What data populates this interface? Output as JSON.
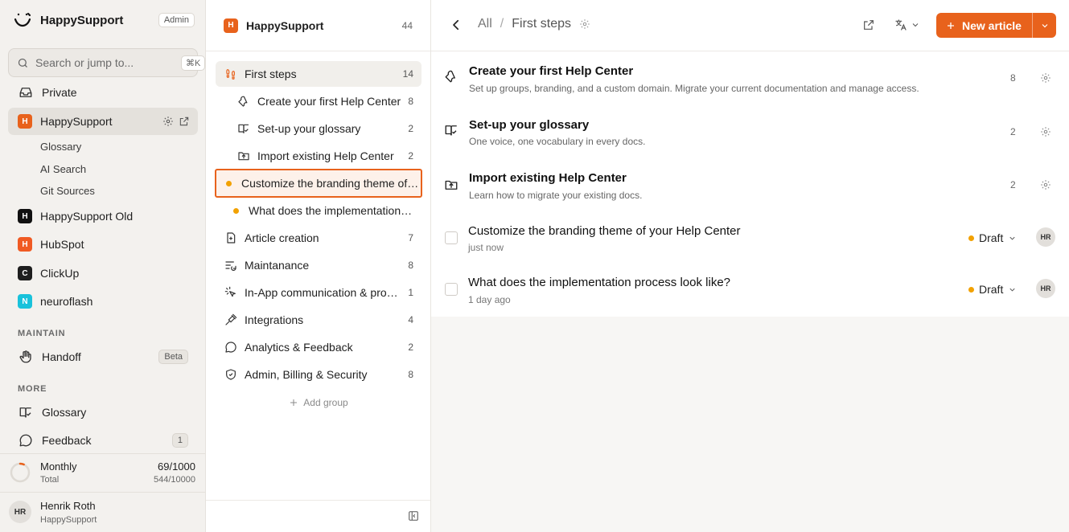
{
  "app": {
    "name": "HappySupport",
    "role_badge": "Admin"
  },
  "search": {
    "placeholder": "Search or jump to...",
    "shortcut": "⌘K"
  },
  "sidebar": {
    "private_label": "Private",
    "active_workspace": {
      "letter": "H",
      "name": "HappySupport",
      "color": "#e8621c"
    },
    "sub_items": [
      "Glossary",
      "AI Search",
      "Git Sources"
    ],
    "workspaces": [
      {
        "letter": "H",
        "name": "HappySupport Old",
        "color": "#111111"
      },
      {
        "letter": "H",
        "name": "HubSpot",
        "color": "#f05a23"
      },
      {
        "letter": "C",
        "name": "ClickUp",
        "color": "#1e1e1e"
      },
      {
        "letter": "N",
        "name": "neuroflash",
        "color": "#19c2db"
      }
    ],
    "maintain_label": "MAINTAIN",
    "handoff": {
      "label": "Handoff",
      "badge": "Beta"
    },
    "more_label": "MORE",
    "glossary_label": "Glossary",
    "feedback": {
      "label": "Feedback",
      "count": "1"
    },
    "usage": {
      "label": "Monthly",
      "sublabel": "Total",
      "monthly": "69/1000",
      "total": "544/10000",
      "fraction": 0.069
    },
    "user": {
      "initials": "HR",
      "name": "Henrik Roth",
      "org": "HappySupport"
    }
  },
  "middle": {
    "header": {
      "letter": "H",
      "name": "HappySupport",
      "count": "44"
    },
    "active_group": {
      "label": "First steps",
      "count": "14"
    },
    "children": [
      {
        "label": "Create your first Help Center",
        "count": "8"
      },
      {
        "label": "Set-up your glossary",
        "count": "2"
      },
      {
        "label": "Import existing Help Center",
        "count": "2"
      }
    ],
    "drafts": [
      {
        "label": "Customize the branding theme of your Help Center"
      },
      {
        "label": "What does the implementation process look like?"
      }
    ],
    "groups": [
      {
        "label": "Article creation",
        "count": "7"
      },
      {
        "label": "Maintanance",
        "count": "8"
      },
      {
        "label": "In-App communication & proactive support",
        "count": "1"
      },
      {
        "label": "Integrations",
        "count": "4"
      },
      {
        "label": "Analytics & Feedback",
        "count": "2"
      },
      {
        "label": "Admin, Billing & Security",
        "count": "8"
      }
    ],
    "add_group_label": "Add group"
  },
  "main": {
    "breadcrumb": {
      "root": "All",
      "sep": "/",
      "current": "First steps"
    },
    "new_article_label": "New article",
    "folders": [
      {
        "title": "Create your first Help Center",
        "desc": "Set up groups, branding, and a custom domain. Migrate your current documentation and manage access.",
        "count": "8",
        "icon": "wrench-icon"
      },
      {
        "title": "Set-up your glossary",
        "desc": "One voice, one vocabulary in every docs.",
        "count": "2",
        "icon": "book-check-icon"
      },
      {
        "title": "Import existing Help Center",
        "desc": "Learn how to migrate your existing docs.",
        "count": "2",
        "icon": "folder-upload-icon"
      }
    ],
    "articles": [
      {
        "title": "Customize the branding theme of your Help Center",
        "time": "just now",
        "status": "Draft",
        "author": "HR"
      },
      {
        "title": "What does the implementation process look like?",
        "time": "1 day ago",
        "status": "Draft",
        "author": "HR"
      }
    ]
  },
  "colors": {
    "accent": "#e8621c",
    "draft": "#f2a100"
  }
}
